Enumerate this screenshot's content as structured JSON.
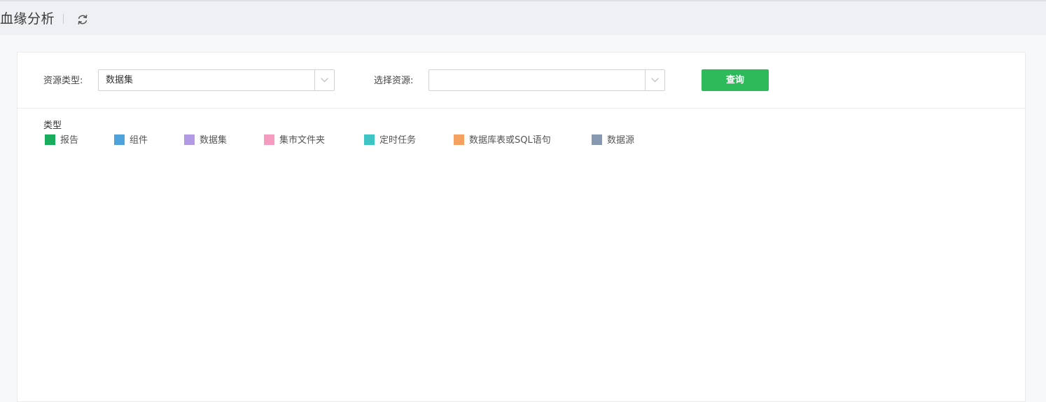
{
  "header": {
    "title": "血缘分析",
    "refresh_icon": "refresh-icon"
  },
  "filters": {
    "resource_type_label": "资源类型:",
    "resource_type_value": "数据集",
    "select_resource_label": "选择资源:",
    "select_resource_value": "",
    "query_label": "查询",
    "query_color": "#2dba5a"
  },
  "legend": {
    "title": "类型",
    "items": [
      {
        "label": "报告",
        "color": "#1aad5e"
      },
      {
        "label": "组件",
        "color": "#4fa3dd"
      },
      {
        "label": "数据集",
        "color": "#b39ae4"
      },
      {
        "label": "集市文件夹",
        "color": "#f59bc0"
      },
      {
        "label": "定时任务",
        "color": "#3ec4c4"
      },
      {
        "label": "数据库表或SQL语句",
        "color": "#f4a162"
      },
      {
        "label": "数据源",
        "color": "#8799b0"
      }
    ]
  }
}
